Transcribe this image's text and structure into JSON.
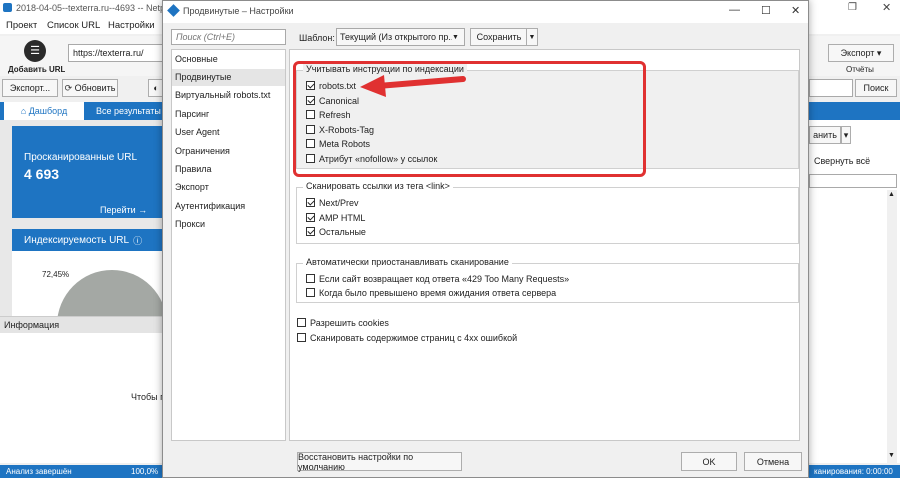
{
  "main": {
    "window_title": "2018-04-05--texterra.ru--4693 -- Netpeak Sp...",
    "menu": [
      "Проект",
      "Список URL",
      "Настройки"
    ],
    "add_url_label": "Добавить URL",
    "url_value": "https://texterra.ru/",
    "export_label": "Экспорт...",
    "refresh_label": "Обновить",
    "export_right_label": "Экспорт",
    "reports_label": "Отчёты",
    "search_label": "Поиск",
    "dashboard_tab": "Дашборд",
    "all_results_tab": "Все результаты (4",
    "scanned_url_label": "Просканированные URL",
    "scanned_url_count": "4 693",
    "goto_label": "Перейти →",
    "indexability_label": "Индексируемость URL",
    "indexability_percent": "72,45%",
    "info_label": "Информация",
    "info_text": "Чтобы п",
    "collapse_all_label": "Свернуть всё",
    "right_btn_partial": "анить",
    "status_left": "Анализ завершён",
    "status_percent": "100,0%",
    "status_right": "канирования: 0:00:00"
  },
  "dialog": {
    "title": "Продвинутые – Настройки",
    "search_placeholder": "Поиск (Ctrl+E)",
    "nav": [
      "Основные",
      "Продвинутые",
      "Виртуальный robots.txt",
      "Парсинг",
      "User Agent",
      "Ограничения",
      "Правила",
      "Экспорт",
      "Аутентификация",
      "Прокси"
    ],
    "template_label": "Шаблон:",
    "template_value": "Текущий (Из открытого пр...",
    "save_label": "Сохранить",
    "group_indexing": {
      "title": "Учитывать инструкции по индексации",
      "items": [
        {
          "label": "robots.txt",
          "checked": true
        },
        {
          "label": "Canonical",
          "checked": true
        },
        {
          "label": "Refresh",
          "checked": false
        },
        {
          "label": "X-Robots-Tag",
          "checked": false
        },
        {
          "label": "Meta Robots",
          "checked": false
        },
        {
          "label": "Атрибут «nofollow» у ссылок",
          "checked": false
        }
      ]
    },
    "group_link": {
      "title": "Сканировать ссылки из тега <link>",
      "items": [
        {
          "label": "Next/Prev",
          "checked": true
        },
        {
          "label": "AMP HTML",
          "checked": true
        },
        {
          "label": "Остальные",
          "checked": true
        }
      ]
    },
    "group_pause": {
      "title": "Автоматически приостанавливать сканирование",
      "items": [
        {
          "label": "Если сайт возвращает код ответа «429 Too Many Requests»",
          "checked": false
        },
        {
          "label": "Когда было превышено время ожидания ответа сервера",
          "checked": false
        }
      ]
    },
    "allow_cookies": {
      "label": "Разрешить cookies",
      "checked": false
    },
    "scan_4xx": {
      "label": "Сканировать содержимое страниц с 4хх ошибкой",
      "checked": false
    },
    "restore_defaults_label": "Восстановить настройки по умолчанию",
    "ok_label": "OK",
    "cancel_label": "Отмена"
  },
  "colors": {
    "accent": "#1e74c2",
    "annotation": "#e03131"
  }
}
